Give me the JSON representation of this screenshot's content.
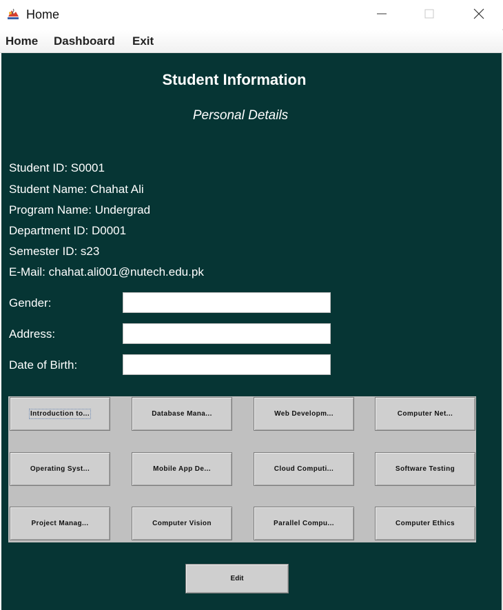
{
  "window": {
    "title": "Home",
    "icon": "java-cup-icon"
  },
  "menu": {
    "items": [
      "Home",
      "Dashboard",
      "Exit"
    ]
  },
  "page": {
    "title": "Student Information",
    "subtitle": "Personal Details"
  },
  "student": {
    "id_line": "Student ID: S0001",
    "name_line": "Student Name: Chahat Ali",
    "program_line": "Program Name: Undergrad",
    "department_line": "Department ID: D0001",
    "semester_line": "Semester ID: s23",
    "email_line": "E-Mail: chahat.ali001@nutech.edu.pk"
  },
  "form": {
    "gender_label": "Gender:",
    "gender_value": "",
    "address_label": "Address:",
    "address_value": "",
    "dob_label": "Date of Birth:",
    "dob_value": ""
  },
  "courses": [
    "Introduction to...",
    "Database Mana...",
    "Web Developm...",
    "Computer Net...",
    "Operating Syst...",
    "Mobile App De...",
    "Cloud Computi...",
    "Software Testing",
    "Project Manag...",
    "Computer Vision",
    "Parallel Compu...",
    "Computer Ethics"
  ],
  "actions": {
    "edit_label": "Edit"
  },
  "colors": {
    "content_background": "#063534",
    "panel_background": "#c0c0c0",
    "button_face": "#cfcfcf"
  }
}
